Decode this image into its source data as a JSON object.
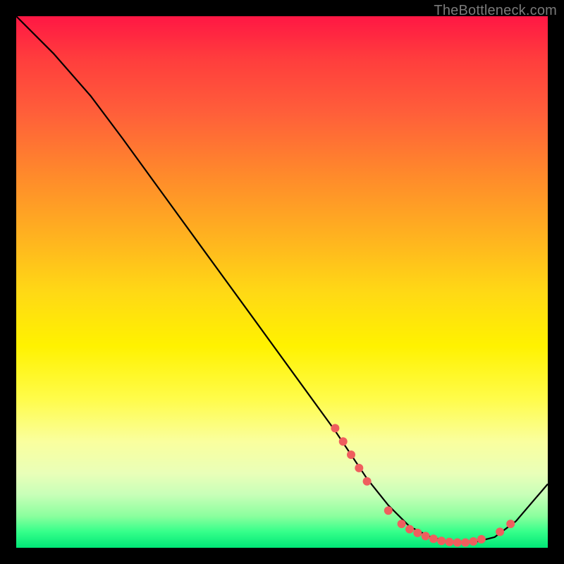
{
  "watermark": "TheBottleneck.com",
  "chart_data": {
    "type": "line",
    "title": "",
    "xlabel": "",
    "ylabel": "",
    "xlim": [
      0,
      100
    ],
    "ylim": [
      0,
      100
    ],
    "grid": false,
    "series": [
      {
        "name": "curve",
        "x": [
          0,
          7,
          14,
          20,
          28,
          36,
          44,
          52,
          60,
          66,
          70,
          74,
          78,
          82,
          86,
          90,
          94,
          100
        ],
        "y": [
          100,
          93,
          85,
          77,
          66,
          55,
          44,
          33,
          22,
          13,
          8,
          4,
          2,
          1,
          1,
          2,
          5,
          12
        ]
      }
    ],
    "markers": [
      {
        "x": 60.0,
        "y": 22.5
      },
      {
        "x": 61.5,
        "y": 20.0
      },
      {
        "x": 63.0,
        "y": 17.5
      },
      {
        "x": 64.5,
        "y": 15.0
      },
      {
        "x": 66.0,
        "y": 12.5
      },
      {
        "x": 70.0,
        "y": 7.0
      },
      {
        "x": 72.5,
        "y": 4.5
      },
      {
        "x": 74.0,
        "y": 3.5
      },
      {
        "x": 75.5,
        "y": 2.8
      },
      {
        "x": 77.0,
        "y": 2.2
      },
      {
        "x": 78.5,
        "y": 1.7
      },
      {
        "x": 80.0,
        "y": 1.3
      },
      {
        "x": 81.5,
        "y": 1.1
      },
      {
        "x": 83.0,
        "y": 1.0
      },
      {
        "x": 84.5,
        "y": 1.0
      },
      {
        "x": 86.0,
        "y": 1.2
      },
      {
        "x": 87.5,
        "y": 1.6
      },
      {
        "x": 91.0,
        "y": 3.0
      },
      {
        "x": 93.0,
        "y": 4.5
      }
    ],
    "marker_color": "#ef5e5e",
    "marker_radius": 6,
    "line_color": "#000000",
    "line_width": 2.2
  }
}
